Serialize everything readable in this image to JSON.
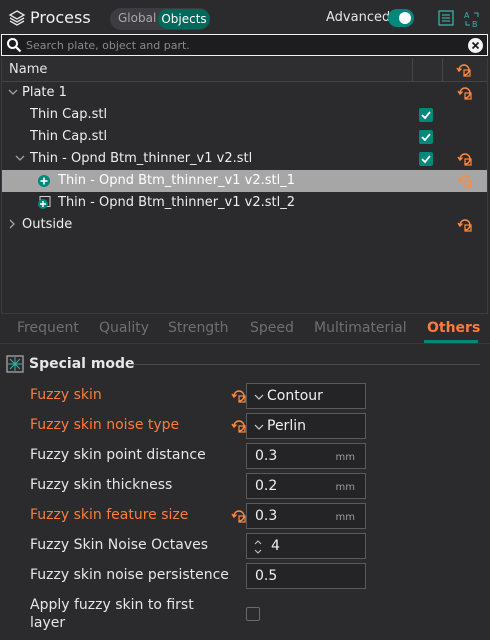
{
  "header": {
    "title": "Process",
    "mode_global": "Global",
    "mode_objects": "Objects",
    "advanced_label": "Advanced",
    "advanced_on": true
  },
  "search": {
    "placeholder": "Search plate, object and part."
  },
  "tree": {
    "column_name": "Name",
    "rows": [
      {
        "label": "Plate 1"
      },
      {
        "label": "Thin Cap.stl"
      },
      {
        "label": "Thin Cap.stl"
      },
      {
        "label": "Thin - Opnd Btm_thinner_v1 v2.stl"
      },
      {
        "label": "Thin - Opnd Btm_thinner_v1 v2.stl_1"
      },
      {
        "label": "Thin - Opnd Btm_thinner_v1 v2.stl_2"
      },
      {
        "label": "Outside"
      }
    ]
  },
  "tabs": [
    "Frequent",
    "Quality",
    "Strength",
    "Speed",
    "Multimaterial",
    "Others"
  ],
  "active_tab": "Others",
  "section": {
    "title": "Special mode"
  },
  "options": [
    {
      "label": "Fuzzy skin",
      "value": "Contour"
    },
    {
      "label": "Fuzzy skin noise type",
      "value": "Perlin"
    },
    {
      "label": "Fuzzy skin point distance",
      "value": "0.3",
      "unit": "mm"
    },
    {
      "label": "Fuzzy skin thickness",
      "value": "0.2",
      "unit": "mm"
    },
    {
      "label": "Fuzzy skin feature size",
      "value": "0.3",
      "unit": "mm"
    },
    {
      "label": "Fuzzy Skin Noise Octaves",
      "value": "4"
    },
    {
      "label": "Fuzzy skin noise persistence",
      "value": "0.5"
    },
    {
      "label_line1": "Apply fuzzy skin to first",
      "label_line2": "layer",
      "checked": false
    }
  ],
  "colors": {
    "accent": "#00897b",
    "modified": "#ff7b3a",
    "selection": "#a6a6a6",
    "background": "#2b2b2e"
  },
  "icons": [
    "process-layers-icon",
    "list-icon",
    "ab-compare-icon",
    "search-icon",
    "clear-icon",
    "reset-icon",
    "part-icon",
    "special-mode-icon"
  ]
}
